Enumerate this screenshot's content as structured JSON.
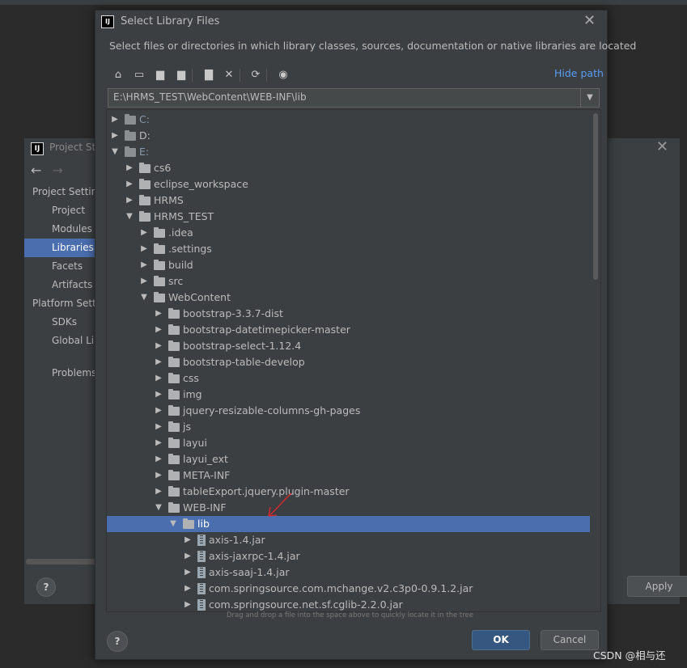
{
  "background_dialog": {
    "title": "Project Str",
    "nav": {
      "back": "←",
      "forward": "→"
    },
    "sidebar": [
      {
        "label": "Project Settin",
        "indent": 0,
        "selected": false
      },
      {
        "label": "Project",
        "indent": 1,
        "selected": false
      },
      {
        "label": "Modules",
        "indent": 1,
        "selected": false
      },
      {
        "label": "Libraries",
        "indent": 1,
        "selected": true
      },
      {
        "label": "Facets",
        "indent": 1,
        "selected": false
      },
      {
        "label": "Artifacts",
        "indent": 1,
        "selected": false
      },
      {
        "label": "Platform Setti",
        "indent": 0,
        "selected": false
      },
      {
        "label": "SDKs",
        "indent": 1,
        "selected": false
      },
      {
        "label": "Global Lib",
        "indent": 1,
        "selected": false
      },
      {
        "label": "Problems",
        "indent": 1,
        "selected": false
      }
    ],
    "help": "?",
    "apply": "Apply"
  },
  "dialog": {
    "logo": "IJ",
    "title": "Select Library Files",
    "close": "✕",
    "description": "Select files or directories in which library classes, sources, documentation or native libraries are located",
    "toolbar": [
      {
        "name": "home-icon",
        "glyph": "⌂"
      },
      {
        "name": "desktop-icon",
        "glyph": "▭"
      },
      {
        "name": "project-folder-icon",
        "glyph": "▆"
      },
      {
        "name": "module-folder-icon",
        "glyph": "▆"
      },
      {
        "name": "new-folder-icon",
        "glyph": "▇"
      },
      {
        "name": "delete-icon",
        "glyph": "✕"
      },
      {
        "name": "refresh-icon",
        "glyph": "⟳"
      },
      {
        "name": "show-hidden-icon",
        "glyph": "◉"
      }
    ],
    "hide_path": "Hide path",
    "path": "E:\\HRMS_TEST\\WebContent\\WEB-INF\\lib",
    "tree": [
      {
        "label": "C:",
        "depth": 0,
        "type": "drive",
        "expanded": false
      },
      {
        "label": "D:",
        "depth": 0,
        "type": "drive",
        "expanded": false
      },
      {
        "label": "E:",
        "depth": 0,
        "type": "drive",
        "expanded": true
      },
      {
        "label": "cs6",
        "depth": 1,
        "type": "folder",
        "expanded": false
      },
      {
        "label": "eclipse_workspace",
        "depth": 1,
        "type": "folder",
        "expanded": false
      },
      {
        "label": "HRMS",
        "depth": 1,
        "type": "folder",
        "expanded": false
      },
      {
        "label": "HRMS_TEST",
        "depth": 1,
        "type": "folder",
        "expanded": true
      },
      {
        "label": ".idea",
        "depth": 2,
        "type": "folder",
        "expanded": false
      },
      {
        "label": ".settings",
        "depth": 2,
        "type": "folder",
        "expanded": false
      },
      {
        "label": "build",
        "depth": 2,
        "type": "folder",
        "expanded": false
      },
      {
        "label": "src",
        "depth": 2,
        "type": "folder",
        "expanded": false
      },
      {
        "label": "WebContent",
        "depth": 2,
        "type": "folder",
        "expanded": true
      },
      {
        "label": "bootstrap-3.3.7-dist",
        "depth": 3,
        "type": "folder",
        "expanded": false
      },
      {
        "label": "bootstrap-datetimepicker-master",
        "depth": 3,
        "type": "folder",
        "expanded": false
      },
      {
        "label": "bootstrap-select-1.12.4",
        "depth": 3,
        "type": "folder",
        "expanded": false
      },
      {
        "label": "bootstrap-table-develop",
        "depth": 3,
        "type": "folder",
        "expanded": false
      },
      {
        "label": "css",
        "depth": 3,
        "type": "folder",
        "expanded": false
      },
      {
        "label": "img",
        "depth": 3,
        "type": "folder",
        "expanded": false
      },
      {
        "label": "jquery-resizable-columns-gh-pages",
        "depth": 3,
        "type": "folder",
        "expanded": false
      },
      {
        "label": "js",
        "depth": 3,
        "type": "folder",
        "expanded": false
      },
      {
        "label": "layui",
        "depth": 3,
        "type": "folder",
        "expanded": false
      },
      {
        "label": "layui_ext",
        "depth": 3,
        "type": "folder",
        "expanded": false
      },
      {
        "label": "META-INF",
        "depth": 3,
        "type": "folder",
        "expanded": false
      },
      {
        "label": "tableExport.jquery.plugin-master",
        "depth": 3,
        "type": "folder",
        "expanded": false
      },
      {
        "label": "WEB-INF",
        "depth": 3,
        "type": "folder",
        "expanded": true
      },
      {
        "label": "lib",
        "depth": 4,
        "type": "folder",
        "expanded": true,
        "selected": true
      },
      {
        "label": "axis-1.4.jar",
        "depth": 5,
        "type": "jar",
        "expanded": false
      },
      {
        "label": "axis-jaxrpc-1.4.jar",
        "depth": 5,
        "type": "jar",
        "expanded": false
      },
      {
        "label": "axis-saaj-1.4.jar",
        "depth": 5,
        "type": "jar",
        "expanded": false
      },
      {
        "label": "com.springsource.com.mchange.v2.c3p0-0.9.1.2.jar",
        "depth": 5,
        "type": "jar",
        "expanded": false
      },
      {
        "label": "com.springsource.net.sf.cglib-2.2.0.jar",
        "depth": 5,
        "type": "jar",
        "expanded": false
      }
    ],
    "hint": "Drag and drop a file into the space above to quickly locate it in the tree",
    "help": "?",
    "ok": "OK",
    "cancel": "Cancel"
  },
  "watermark": "CSDN @相与还",
  "colors": {
    "selection": "#4b6eaf",
    "link": "#589df6",
    "annotation_arrow": "#e0282d"
  }
}
